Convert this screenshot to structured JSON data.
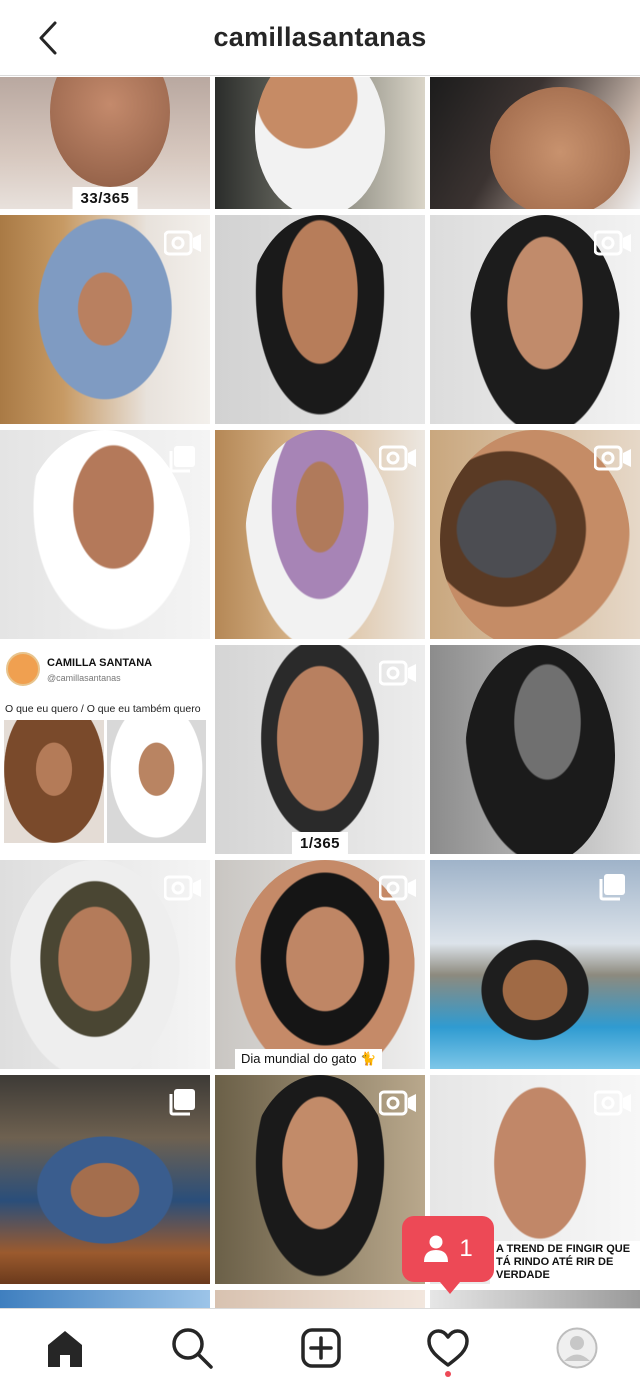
{
  "header": {
    "title": "camillasantanas"
  },
  "posts": [
    {
      "badge": "33/365"
    },
    {},
    {},
    {
      "icon": "igtv-icon"
    },
    {},
    {
      "icon": "igtv-icon"
    },
    {
      "icon": "carousel-icon"
    },
    {
      "icon": "igtv-icon"
    },
    {
      "icon": "igtv-icon"
    },
    {
      "tweet": {
        "name": "CAMILLA SANTANA",
        "handle": "@camillasantanas",
        "text": "O que eu quero / O que eu também quero"
      }
    },
    {
      "icon": "igtv-icon",
      "badge": "1/365"
    },
    {},
    {
      "icon": "igtv-icon"
    },
    {
      "icon": "igtv-icon",
      "caption": "Dia mundial do gato 🐈"
    },
    {
      "icon": "carousel-icon"
    },
    {
      "icon": "carousel-icon"
    },
    {
      "icon": "igtv-icon"
    },
    {
      "icon": "igtv-icon",
      "caption": "A TREND DE FINGIR QUE TÁ RINDO ATÉ RIR DE VERDADE"
    }
  ],
  "notification": {
    "count": "1",
    "icon": "person-icon"
  },
  "tabbar": {
    "items": [
      "home-icon",
      "search-icon",
      "new-post-icon",
      "activity-heart-icon",
      "profile-avatar"
    ]
  }
}
